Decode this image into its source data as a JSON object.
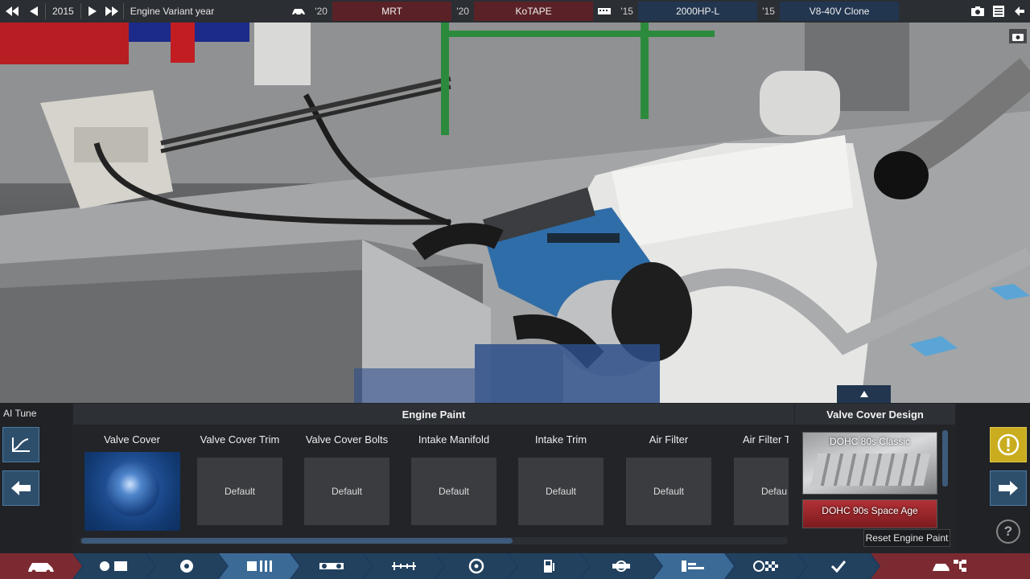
{
  "topbar": {
    "year": "2015",
    "variant_label": "Engine Variant year",
    "slots": [
      {
        "year": "'20",
        "name": "MRT"
      },
      {
        "year": "'20",
        "name": "KoTAPE"
      },
      {
        "year": "'15",
        "name": "2000HP-L"
      },
      {
        "year": "'15",
        "name": "V8-40V Clone"
      }
    ]
  },
  "panel": {
    "ai_tune": "AI Tune",
    "engine_paint_title": "Engine Paint",
    "valve_cover_design_title": "Valve Cover Design",
    "paint_items": [
      {
        "label": "Valve Cover",
        "value": ""
      },
      {
        "label": "Valve Cover Trim",
        "value": "Default"
      },
      {
        "label": "Valve Cover Bolts",
        "value": "Default"
      },
      {
        "label": "Intake Manifold",
        "value": "Default"
      },
      {
        "label": "Intake Trim",
        "value": "Default"
      },
      {
        "label": "Air Filter",
        "value": "Default"
      },
      {
        "label": "Air Filter T",
        "value": "Defau"
      }
    ],
    "designs": [
      {
        "name": "DOHC 80s Classic"
      },
      {
        "name": "DOHC 90s Space Age"
      }
    ],
    "reset_tooltip": "Reset Engine Paint"
  },
  "colors": {
    "accent_blue": "#2e4f6c",
    "warning_yellow": "#c9ad1f",
    "nav_blue": "#1d3a5c",
    "nav_red": "#7a2a30"
  }
}
